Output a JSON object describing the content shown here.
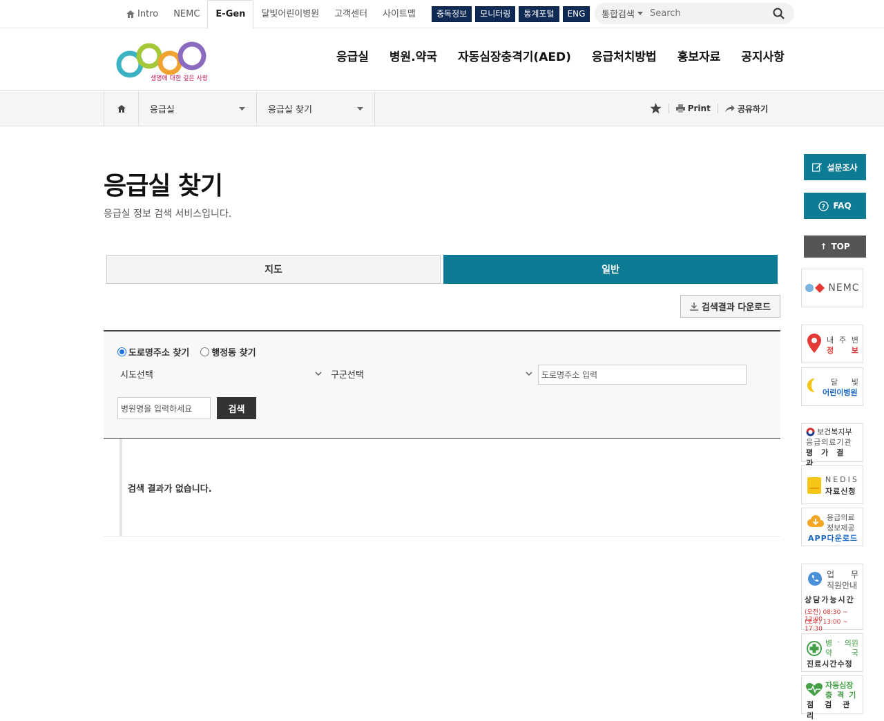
{
  "topbar": {
    "links": [
      {
        "label": "Intro"
      },
      {
        "label": "NEMC"
      },
      {
        "label": "E-Gen"
      },
      {
        "label": "달빛어린이병원"
      },
      {
        "label": "고객센터"
      },
      {
        "label": "사이트맵"
      }
    ],
    "badges": [
      "중독정보",
      "모니터링",
      "통계포털",
      "ENG"
    ],
    "search": {
      "scope": "통합검색",
      "placeholder": "Search"
    }
  },
  "logo": {
    "tagline": "생명에 대한 깊은 사랑"
  },
  "gnb": [
    "응급실",
    "병원.약국",
    "자동심장충격기(AED)",
    "응급처치방법",
    "홍보자료",
    "공지사항"
  ],
  "location": {
    "menu1": "응급실",
    "menu2": "응급실 찾기",
    "print": "Print",
    "share": "공유하기"
  },
  "page": {
    "title": "응급실 찾기",
    "subtitle": "응급실 정보 검색 서비스입니다."
  },
  "tabs": {
    "map": "지도",
    "general": "일반"
  },
  "download_label": "검색결과 다운로드",
  "search_panel": {
    "radio_road": "도로명주소 찾기",
    "radio_admin": "행정동 찾기",
    "sido": "시도선택",
    "gugun": "구군선택",
    "road_placeholder": "도로명주소 입력",
    "hospital_placeholder": "병원명을 입력하세요",
    "search_btn": "검색"
  },
  "results": {
    "empty": "검색 결과가 없습니다."
  },
  "quick": {
    "survey": "설문조사",
    "faq": "FAQ",
    "top": "TOP"
  },
  "banners": {
    "nemc": "NEMC",
    "myinfo": [
      "내",
      "주",
      "변",
      "정",
      "보"
    ],
    "moonlight": [
      "달",
      "빛",
      "어린이병원"
    ],
    "mohw": [
      "보건복지부",
      "응급의료기관",
      "평가결과"
    ],
    "nedis": [
      "NEDIS",
      "자료신청"
    ],
    "app": [
      "응급의료",
      "정보제공",
      "APP다운로드"
    ],
    "staff": [
      "업",
      "무",
      "직원안내",
      "상담가능시간",
      "(오전) 08:30 ~ 12:00",
      "(오후) 13:00 ~ 17:30"
    ],
    "clinic": [
      "병",
      "·",
      "의원",
      "약",
      "국",
      "진료시간수정"
    ],
    "aed": [
      "자동심장",
      "충격기",
      "점검관리"
    ]
  },
  "colors": {
    "primary": "#0d7b93",
    "dark": "#444444",
    "navy": "#102a56"
  }
}
